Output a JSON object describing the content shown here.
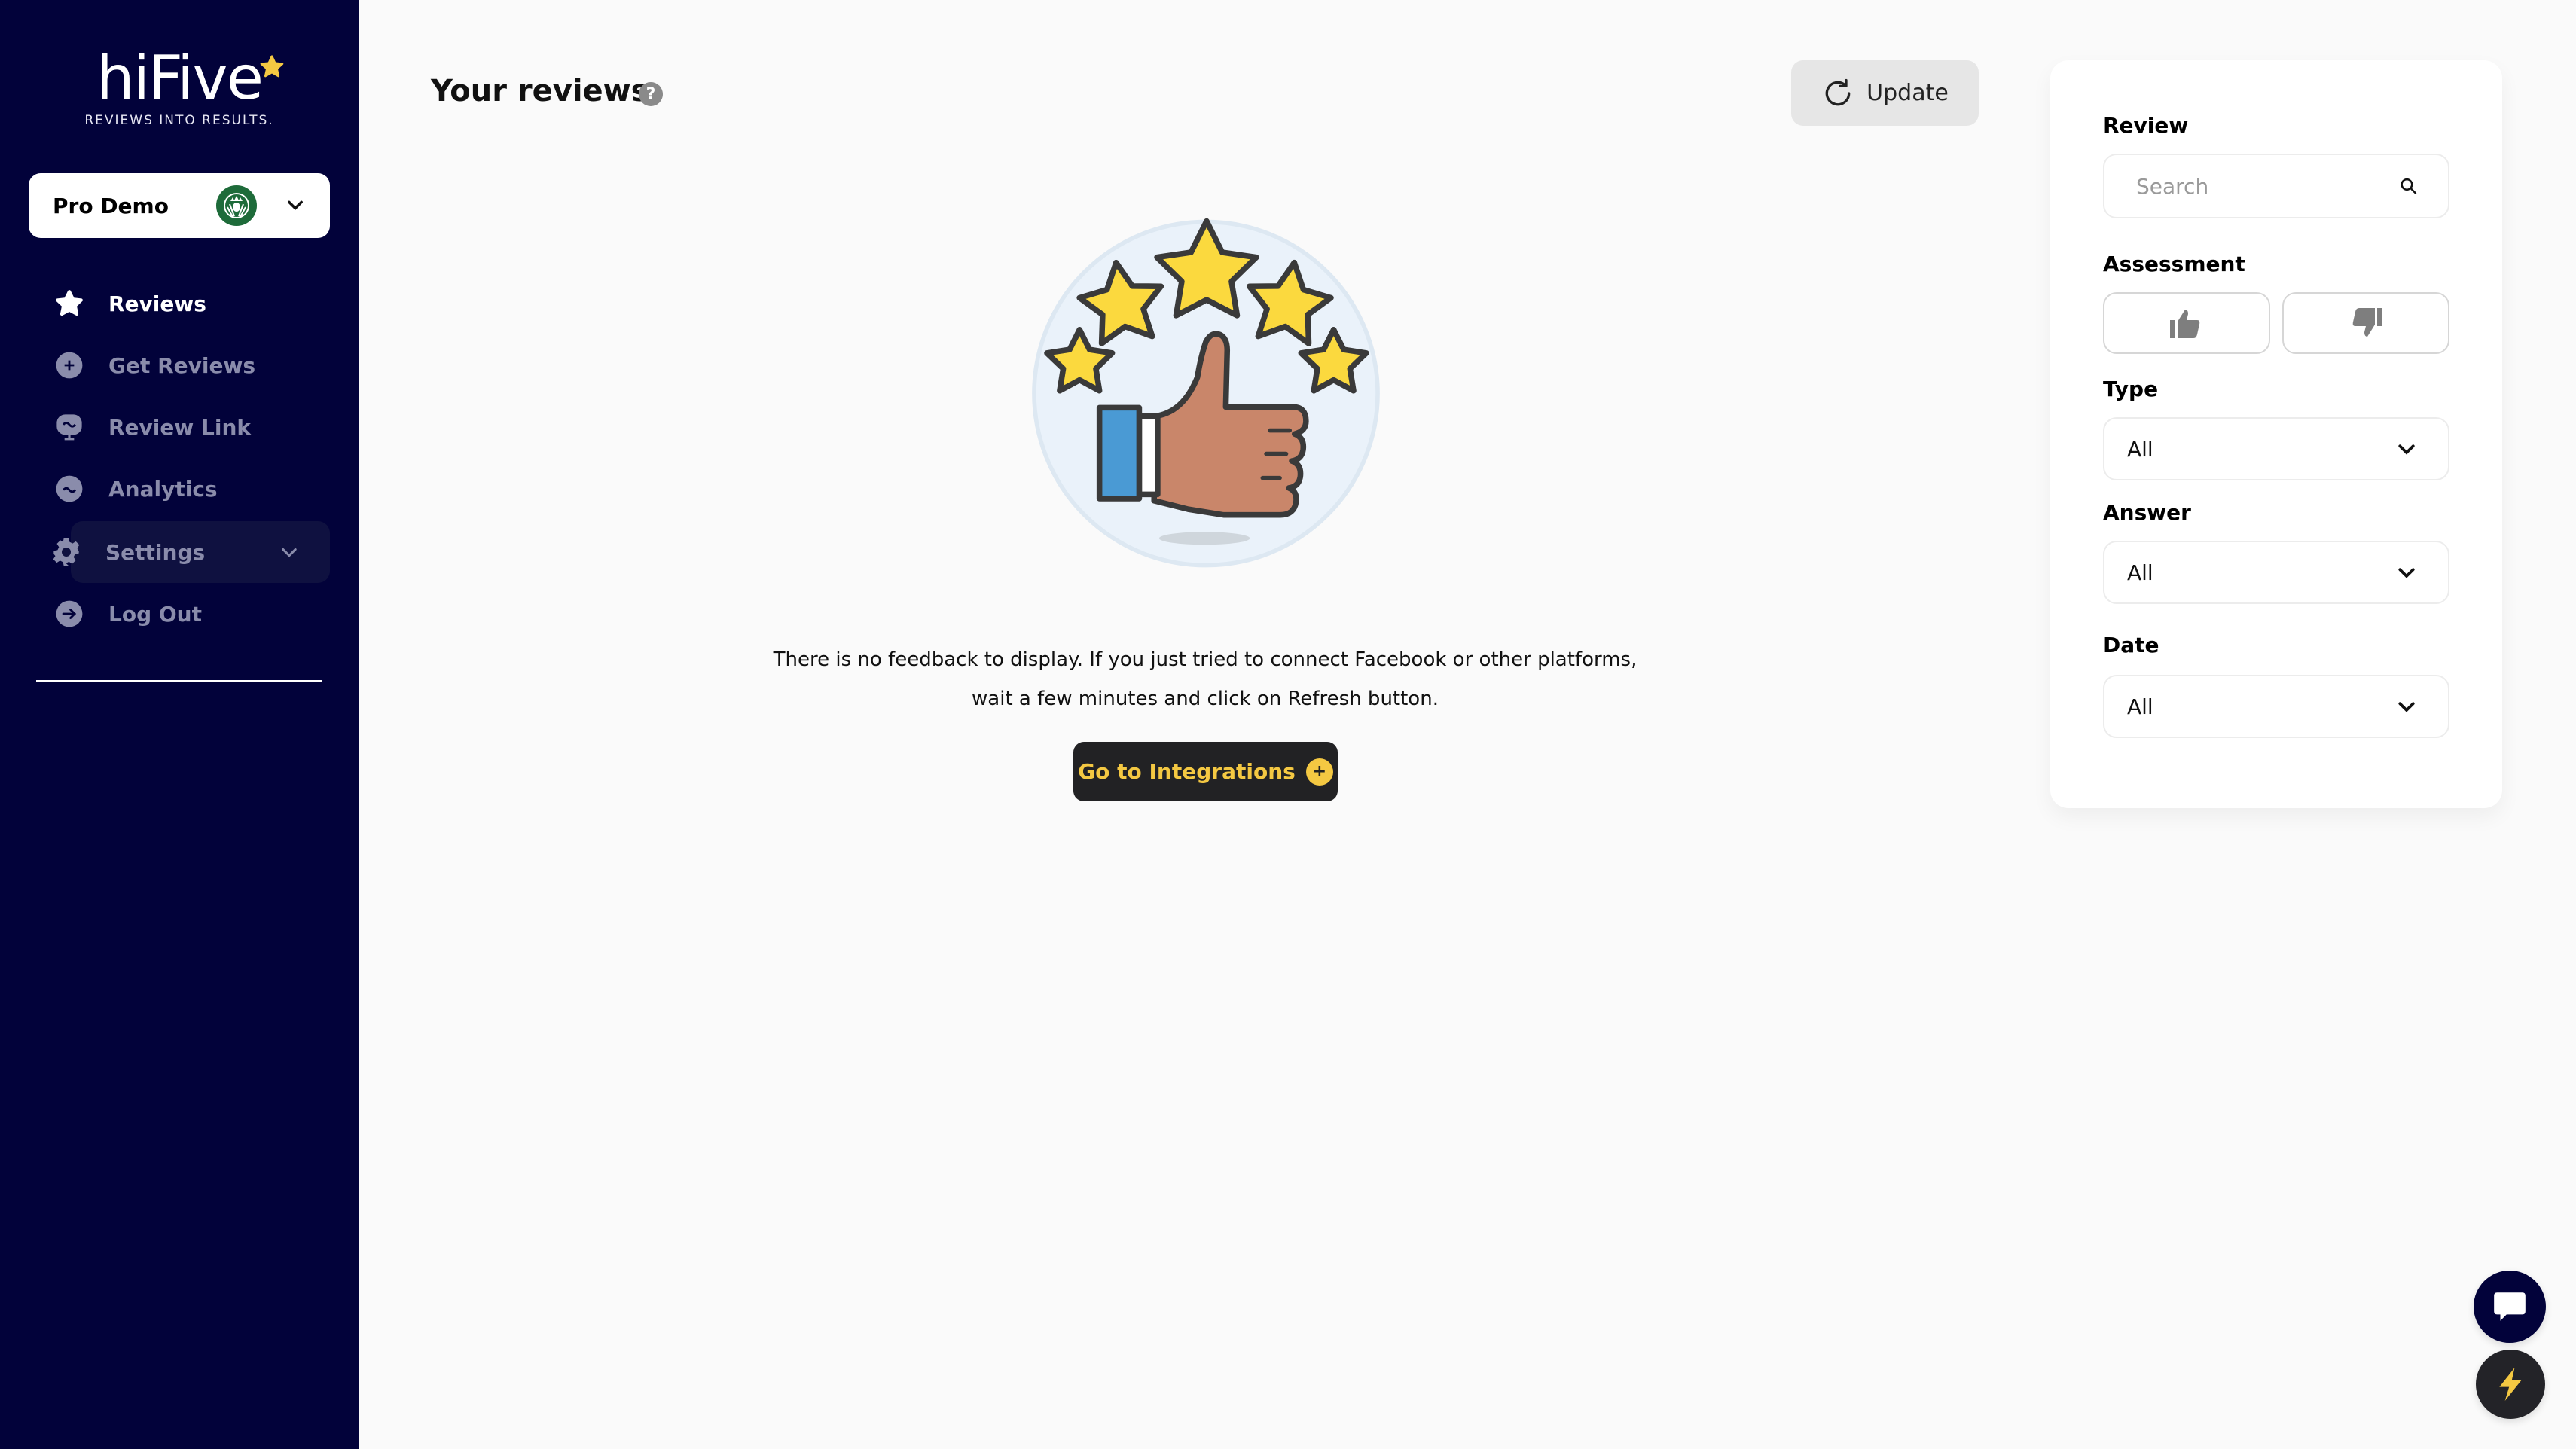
{
  "brand": {
    "name": "hiFive",
    "tagline": "REVIEWS INTO RESULTS.",
    "colors": {
      "sidebar": "#02023a",
      "accent": "#f4c842",
      "dark_button": "#222224"
    }
  },
  "account": {
    "name": "Pro Demo",
    "logo_icon": "starbucks-logo"
  },
  "sidebar": {
    "items": [
      {
        "label": "Reviews",
        "icon": "star-icon",
        "active": true
      },
      {
        "label": "Get Reviews",
        "icon": "plus-circle-icon",
        "active": false
      },
      {
        "label": "Review Link",
        "icon": "monitor-icon",
        "active": false
      },
      {
        "label": "Analytics",
        "icon": "analytics-icon",
        "active": false
      },
      {
        "label": "Settings",
        "icon": "gear-icon",
        "active": false,
        "expandable": true
      },
      {
        "label": "Log Out",
        "icon": "logout-icon",
        "active": false
      }
    ]
  },
  "header": {
    "title": "Your reviews",
    "help": "?",
    "update_label": "Update"
  },
  "empty_state": {
    "line1": "There is no feedback to display. If you just tried to connect Facebook or other platforms,",
    "line2": "wait a few minutes and click on Refresh button.",
    "button_label": "Go to Integrations",
    "button_icon": "+"
  },
  "filters": {
    "review": {
      "label": "Review",
      "placeholder": "Search",
      "value": ""
    },
    "assessment": {
      "label": "Assessment",
      "options": [
        "thumbs-up",
        "thumbs-down"
      ]
    },
    "type": {
      "label": "Type",
      "value": "All"
    },
    "answer": {
      "label": "Answer",
      "value": "All"
    },
    "date": {
      "label": "Date",
      "value": "All"
    }
  }
}
